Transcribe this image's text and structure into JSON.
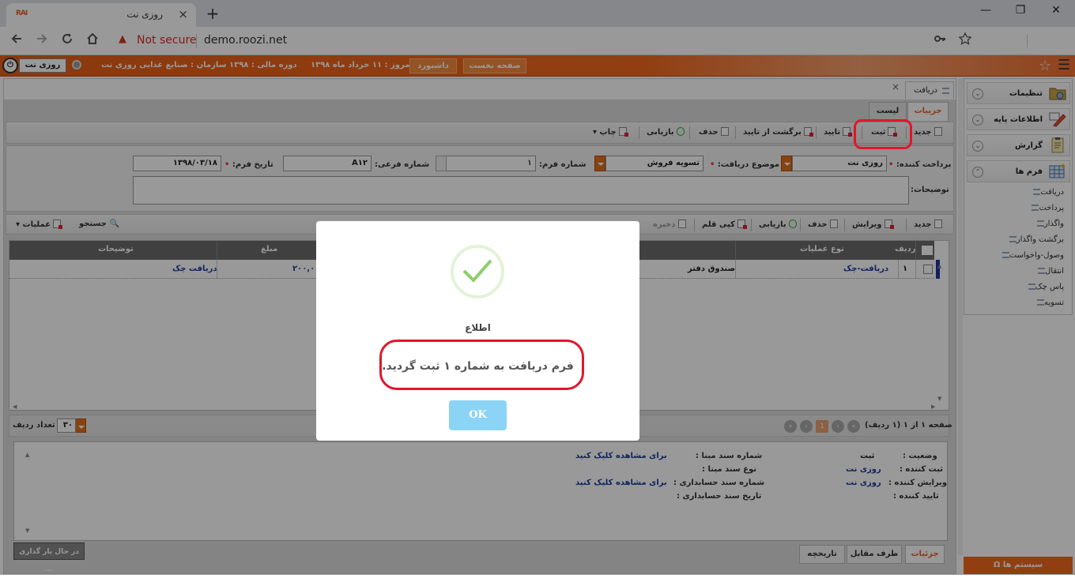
{
  "browser": {
    "tab_title": "روزی نت",
    "favicon_text": "RAI",
    "tab_close": "×",
    "new_tab": "+",
    "win_min": "—",
    "win_max": "❐",
    "win_close": "✕",
    "not_secure": "Not secure",
    "url": "demo.roozi.net"
  },
  "appbar": {
    "user": "روزی نت",
    "org": "سازمان : صنایع غذایی روزی نت",
    "fiscal_year": "دوره مالی : ۱۳۹۸",
    "today": "امروز : ۱۱ خرداد ماه ۱۳۹۸",
    "dashboard_button": "داشبورد",
    "home_button": "صفحه نخست"
  },
  "sidebar": {
    "sections": [
      {
        "label": "تنظیمات",
        "icon": "settings-folder-icon"
      },
      {
        "label": "اطلاعات پایه",
        "icon": "pencil-icon"
      },
      {
        "label": "گزارش",
        "icon": "clipboard-icon"
      },
      {
        "label": "فرم ها",
        "icon": "table-icon"
      }
    ],
    "forms": [
      "دریافت",
      "پرداخت",
      "واگذار",
      "برگشت واگذار",
      "وصول-واخواست",
      "انتقال",
      "پاس چک",
      "تسویه"
    ],
    "system_button": "سیستم ها",
    "system_icon": "Ω"
  },
  "main": {
    "doc_tab": "دریافت",
    "doc_tab_close": "×",
    "subtabs": {
      "details": "جزییات",
      "list": "لیست"
    },
    "toolbar1": {
      "new": "جدید",
      "register": "ثبت",
      "confirm": "تایید",
      "revert": "برگشت از تایید",
      "delete": "حذف",
      "refresh": "بازیابی",
      "print": "چاپ"
    },
    "form": {
      "payer_label": "پرداخت کننده:",
      "payer_value": "روزی نت",
      "subject_label": "موضوع دریافت:",
      "subject_value": "تسویه فروش",
      "form_no_label": "شماره فرم:",
      "form_no_value": "۱",
      "sub_no_label": "شماره فرعی:",
      "sub_no_value": "A۱۲",
      "date_label": "تاریخ فرم:",
      "date_value": "۱۳۹۸/۰۳/۱۸",
      "notes_label": "توضیحات:",
      "required_mark": "•"
    },
    "toolbar2": {
      "new": "جدید",
      "edit": "ویرایش",
      "delete": "حذف",
      "refresh": "بازیابی",
      "copy_item": "کپی قلم",
      "save": "ذخیره",
      "search": "جستجو",
      "operations": "عملیات"
    },
    "grid": {
      "columns": [
        "ردیف",
        "نوع عملیات",
        "",
        "مبلغ",
        "توضیحات"
      ],
      "rows": [
        {
          "index": "۱",
          "operation": "دریافت-چک",
          "account": "صندوق دفتر",
          "amount": "۲۰۰,۰",
          "description": "دریافت چک"
        }
      ]
    },
    "pager": {
      "info": "صفحه ۱ از ۱ (۱ ردیف)",
      "current_page": "1",
      "page_size": "۳۰",
      "page_size_label": "تعداد ردیف"
    },
    "detail": {
      "status_label": "وضعیت :",
      "status_value": "ثبت",
      "registrar_label": "ثبت کننده :",
      "registrar_value": "روزی نت",
      "editor_label": "ویرایش کننده :",
      "editor_value": "روزی نت",
      "approver_label": "تایید کننده :",
      "src_doc_no_label": "شماره سند مبنا :",
      "src_doc_type_label": "نوع سند مبنا :",
      "acc_doc_no_label": "شماره سند حسابداری :",
      "acc_doc_date_label": "تاریخ سند حسابداری :",
      "click_to_view_1": "برای مشاهده کلیک کنید",
      "click_to_view_2": "برای مشاهده کلیک کنید"
    },
    "bottom_tabs": {
      "details": "جزئیات",
      "counterparty": "طرف مقابل",
      "history": "تاریخچه"
    },
    "loading": "در حال بار گذاری ..."
  },
  "modal": {
    "title": "اطلاع",
    "message": "فرم دریافت به شماره ۱ ثبت گردید.",
    "ok": "OK"
  },
  "colors": {
    "accent": "#f26a1f",
    "highlight_ring": "#e0162b",
    "ok_button": "#8cd4f5",
    "link_blue": "#1c3f9e"
  }
}
